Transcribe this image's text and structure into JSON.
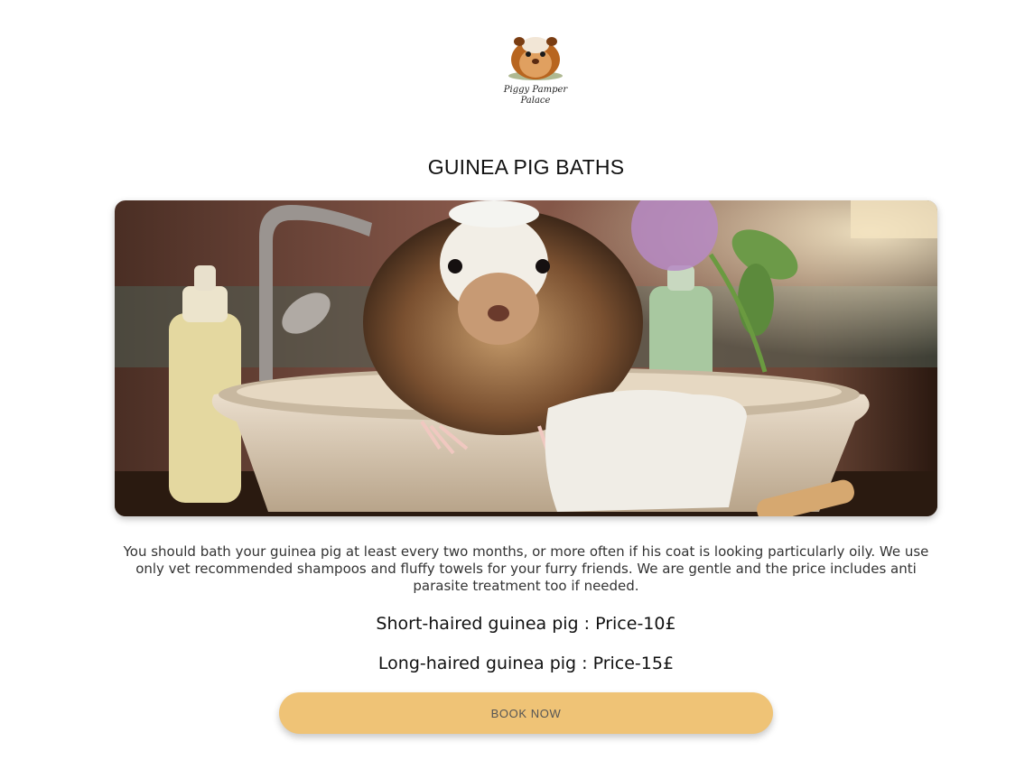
{
  "header": {
    "logo_line1": "Piggy Pamper",
    "logo_line2": "Palace"
  },
  "main": {
    "title": "GUINEA PIG BATHS",
    "hero_image_icon": "guinea-pig-in-bathtub-photo",
    "description": "You should bath your guinea pig at least every two months, or more often if his coat is looking particularly oily. We use only vet recommended shampoos and fluffy towels for your furry friends. We are gentle and the price includes anti parasite treatment too if needed.",
    "price_short": "Short-haired guinea pig : Price-10£",
    "price_long": "Long-haired guinea pig : Price-15£",
    "book_label": "BOOK NOW"
  },
  "colors": {
    "button_bg": "#efc376",
    "button_text": "#555555",
    "title": "#111111"
  }
}
